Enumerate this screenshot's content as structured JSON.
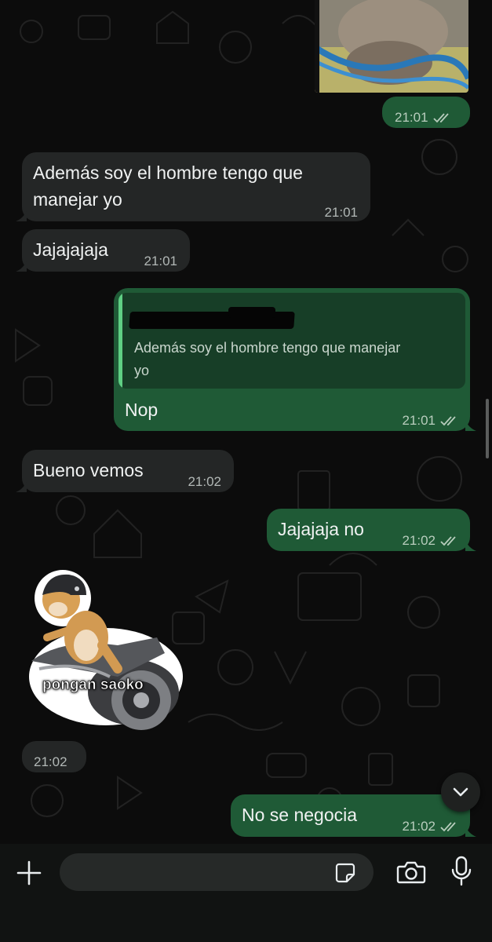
{
  "messages": [
    {
      "id": "m0",
      "direction": "outgoing",
      "type": "image",
      "time": "21:01",
      "read": true
    },
    {
      "id": "m1",
      "direction": "incoming",
      "text_line1": "Además soy el hombre tengo que",
      "text_line2": "manejar yo",
      "time": "21:01"
    },
    {
      "id": "m2",
      "direction": "incoming",
      "text": "Jajajajaja",
      "time": "21:01"
    },
    {
      "id": "m3",
      "direction": "outgoing",
      "quoted_text_line1": "Además soy el hombre tengo que manejar",
      "quoted_text_line2": "yo",
      "text": "Nop",
      "time": "21:01",
      "read": true
    },
    {
      "id": "m4",
      "direction": "incoming",
      "text": "Bueno vemos",
      "time": "21:02"
    },
    {
      "id": "m5",
      "direction": "outgoing",
      "text": "Jajajaja no",
      "time": "21:02",
      "read": true
    },
    {
      "id": "m6",
      "direction": "incoming",
      "type": "sticker",
      "sticker_caption": "pongan saoko",
      "time": "21:02"
    },
    {
      "id": "m7",
      "direction": "outgoing",
      "text": "No se negocia",
      "time": "21:02",
      "read": true
    }
  ],
  "input_bar": {
    "placeholder": "",
    "icons": [
      "plus-icon",
      "sticker-icon",
      "camera-icon",
      "microphone-icon"
    ]
  },
  "scroll_button": {
    "icon": "chevron-down-icon"
  },
  "colors": {
    "incoming_bubble": "#242626",
    "outgoing_bubble": "#1f5a36",
    "quote_bar": "#5fcf84",
    "read_ticks": "#b8cdbd"
  }
}
